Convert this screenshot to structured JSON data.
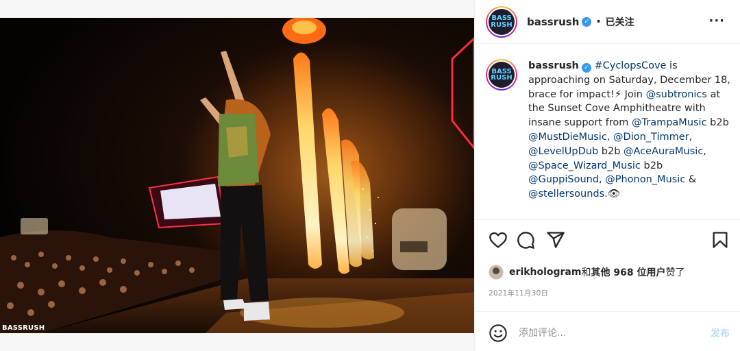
{
  "media": {
    "watermark": "BASSRUSH"
  },
  "header": {
    "username": "bassrush",
    "dot": "•",
    "follow_status": "已关注",
    "more": "···"
  },
  "avatar": {
    "text": "BASS RUSH"
  },
  "caption": {
    "username": "bassrush",
    "parts": [
      "#CyclopsCove",
      " is approaching on Saturday, December 18, brace for impact!⚡ Join ",
      "@subtronics",
      " at the Sunset Cove Amphitheatre with insane support from ",
      "@TrampaMusic",
      " b2b ",
      "@MustDieMusic",
      ", ",
      "@Dion_Timmer",
      ", ",
      "@LevelUpDub",
      " b2b ",
      "@AceAuraMusic",
      ", ",
      "@Space_Wizard_Music",
      " b2b ",
      "@GuppiSound",
      ", ",
      "@Phonon_Music",
      " & ",
      "@stellersounds",
      ".👁"
    ]
  },
  "likes": {
    "user": "erikhologram",
    "and": " 和 ",
    "others": "其他 968 位用户",
    "liked": " 赞了"
  },
  "date": "2021年11月30日",
  "comment": {
    "placeholder": "添加评论...",
    "post_label": "发布"
  },
  "colors": {
    "link": "#00376b",
    "verified": "#3897f0",
    "post_disabled": "#b2dffc"
  },
  "icons": [
    "heart-icon",
    "comment-icon",
    "share-icon",
    "bookmark-icon",
    "emoji-icon",
    "more-icon",
    "verified-icon"
  ]
}
